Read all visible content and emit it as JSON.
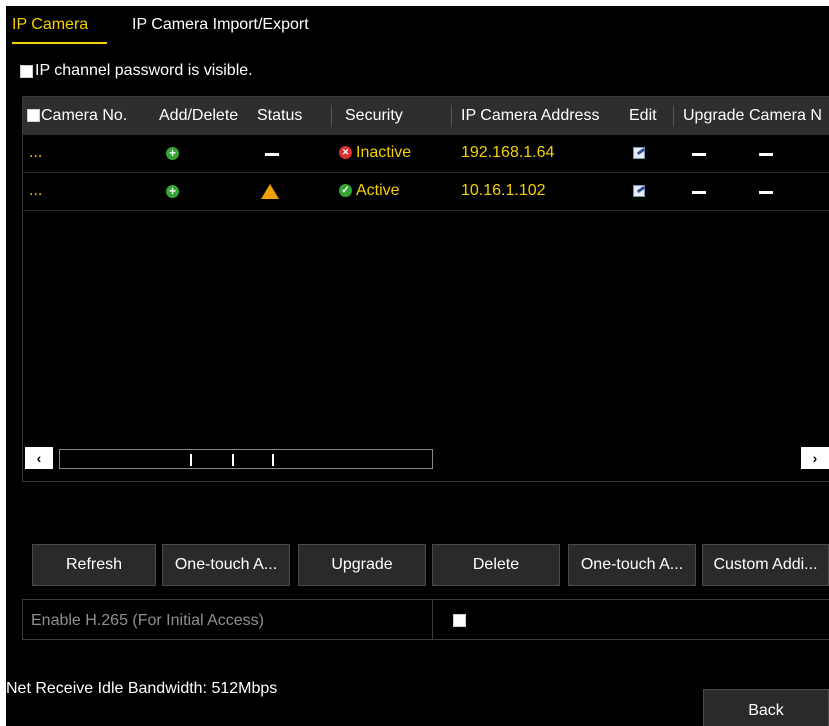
{
  "tabs": [
    {
      "label": "IP Camera",
      "active": true
    },
    {
      "label": "IP Camera Import/Export",
      "active": false
    }
  ],
  "password_visible_label": "IP channel password is visible.",
  "table": {
    "headers": [
      "Camera No.",
      "Add/Delete",
      "Status",
      "Security",
      "IP Camera Address",
      "Edit",
      "Upgrade",
      "Camera N"
    ],
    "rows": [
      {
        "camera_no": "...",
        "add_icon": "plus-icon",
        "status_icon": "dash-icon",
        "security": "Inactive",
        "security_icon": "x-icon",
        "ip": "192.168.1.64",
        "edit_icon": "edit-icon",
        "upgrade_icon": "dash-icon",
        "camera_name_icon": "dash-icon"
      },
      {
        "camera_no": "...",
        "add_icon": "plus-icon",
        "status_icon": "warning-icon",
        "security": "Active",
        "security_icon": "check-icon",
        "ip": "10.16.1.102",
        "edit_icon": "edit-icon",
        "upgrade_icon": "dash-icon",
        "camera_name_icon": "dash-icon"
      }
    ]
  },
  "scroll": {
    "left": "‹",
    "right": "›"
  },
  "buttons": {
    "refresh": "Refresh",
    "one_touch_1": "One-touch A...",
    "upgrade": "Upgrade",
    "delete": "Delete",
    "one_touch_2": "One-touch A...",
    "custom_add": "Custom Addi..."
  },
  "h265_label": "Enable H.265 (For Initial Access)",
  "bandwidth": "Net Receive Idle Bandwidth: 512Mbps",
  "back": "Back",
  "colors": {
    "accent": "#f5d000",
    "background": "#000000"
  }
}
